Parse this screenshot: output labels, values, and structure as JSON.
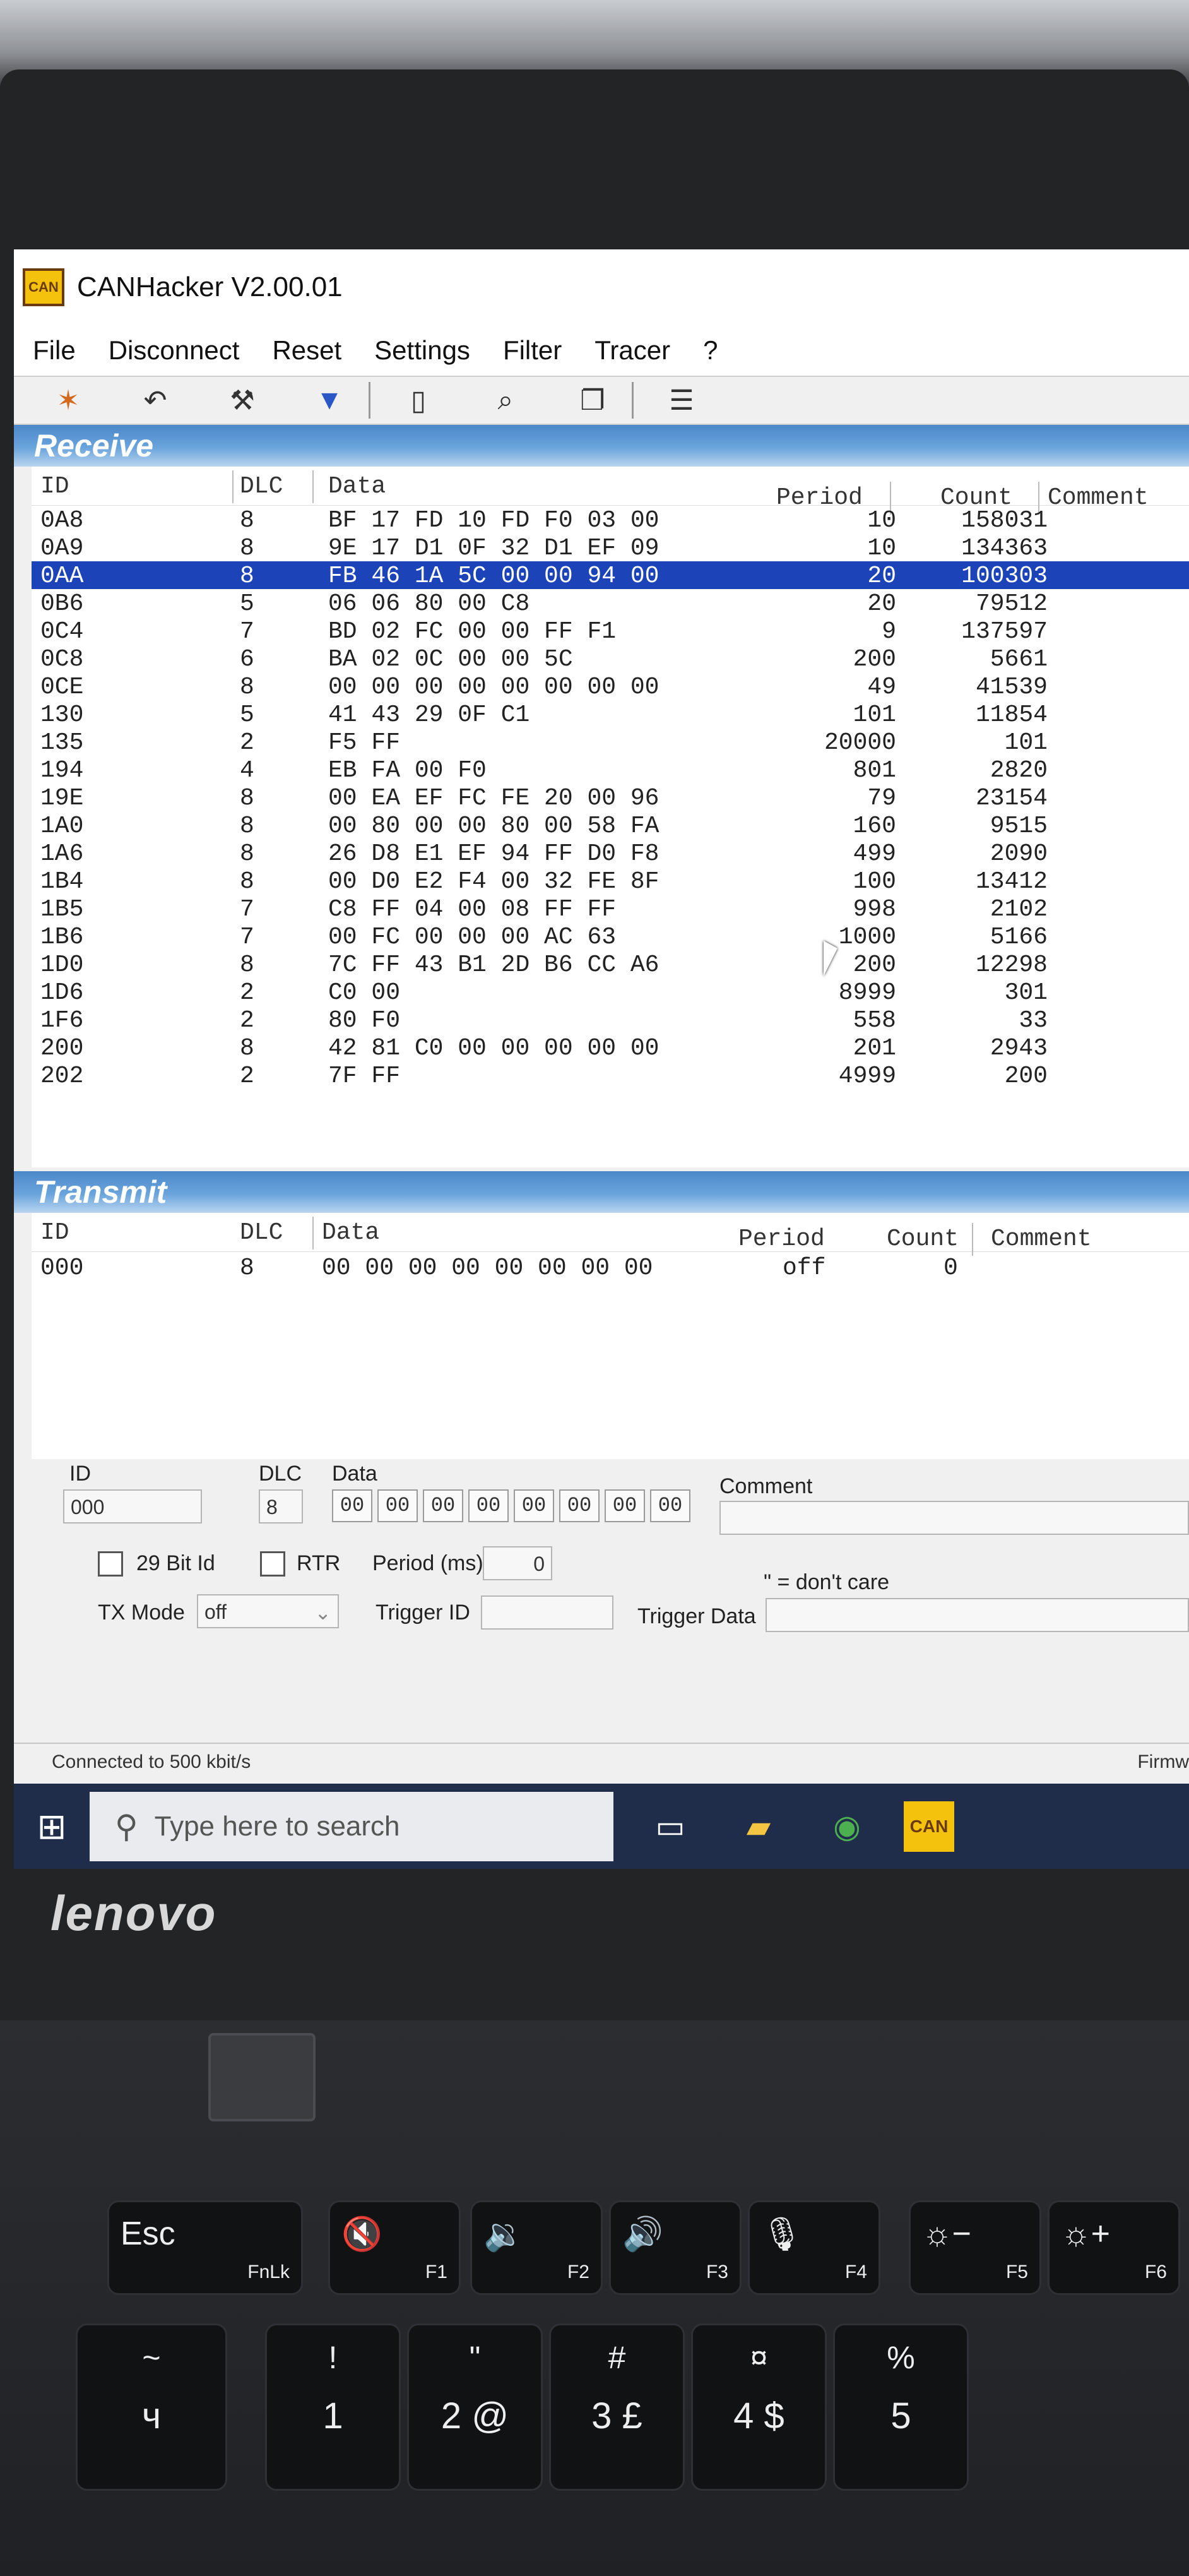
{
  "window": {
    "title": "CANHacker V2.00.01",
    "icon_text": "CAN"
  },
  "menu": [
    "File",
    "Disconnect",
    "Reset",
    "Settings",
    "Filter",
    "Tracer",
    "?"
  ],
  "toolbar_icons": [
    "connect-icon",
    "undo-icon",
    "tools-icon",
    "filter-icon",
    "new-file-icon",
    "preview-icon",
    "copy-icon",
    "log-icon"
  ],
  "receive": {
    "header": "Receive",
    "columns": {
      "id": "ID",
      "dlc": "DLC",
      "data": "Data",
      "period": "Period",
      "count": "Count",
      "comment": "Comment"
    },
    "rows": [
      {
        "id": "0A8",
        "dlc": "8",
        "data": "BF 17 FD 10 FD F0 03 00",
        "period": "10",
        "count": "158031"
      },
      {
        "id": "0A9",
        "dlc": "8",
        "data": "9E 17 D1 0F 32 D1 EF 09",
        "period": "10",
        "count": "134363"
      },
      {
        "id": "0AA",
        "dlc": "8",
        "data": "FB 46 1A 5C 00 00 94 00",
        "period": "20",
        "count": "100303"
      },
      {
        "id": "0B6",
        "dlc": "5",
        "data": "06 06 80 00 C8",
        "period": "20",
        "count": "79512"
      },
      {
        "id": "0C4",
        "dlc": "7",
        "data": "BD 02 FC 00 00 FF F1",
        "period": "9",
        "count": "137597"
      },
      {
        "id": "0C8",
        "dlc": "6",
        "data": "BA 02 0C 00 00 5C",
        "period": "200",
        "count": "5661"
      },
      {
        "id": "0CE",
        "dlc": "8",
        "data": "00 00 00 00 00 00 00 00",
        "period": "49",
        "count": "41539"
      },
      {
        "id": "130",
        "dlc": "5",
        "data": "41 43 29 0F C1",
        "period": "101",
        "count": "11854"
      },
      {
        "id": "135",
        "dlc": "2",
        "data": "F5 FF",
        "period": "20000",
        "count": "101"
      },
      {
        "id": "194",
        "dlc": "4",
        "data": "EB FA 00 F0",
        "period": "801",
        "count": "2820"
      },
      {
        "id": "19E",
        "dlc": "8",
        "data": "00 EA EF FC FE 20 00 96",
        "period": "79",
        "count": "23154"
      },
      {
        "id": "1A0",
        "dlc": "8",
        "data": "00 80 00 00 80 00 58 FA",
        "period": "160",
        "count": "9515"
      },
      {
        "id": "1A6",
        "dlc": "8",
        "data": "26 D8 E1 EF 94 FF D0 F8",
        "period": "499",
        "count": "2090"
      },
      {
        "id": "1B4",
        "dlc": "8",
        "data": "00 D0 E2 F4 00 32 FE 8F",
        "period": "100",
        "count": "13412"
      },
      {
        "id": "1B5",
        "dlc": "7",
        "data": "C8 FF 04 00 08 FF FF",
        "period": "998",
        "count": "2102"
      },
      {
        "id": "1B6",
        "dlc": "7",
        "data": "00 FC 00 00 00 AC 63",
        "period": "1000",
        "count": "5166"
      },
      {
        "id": "1D0",
        "dlc": "8",
        "data": "7C FF 43 B1 2D B6 CC A6",
        "period": "200",
        "count": "12298"
      },
      {
        "id": "1D6",
        "dlc": "2",
        "data": "C0 00",
        "period": "8999",
        "count": "301"
      },
      {
        "id": "1F6",
        "dlc": "2",
        "data": "80 F0",
        "period": "558",
        "count": "33"
      },
      {
        "id": "200",
        "dlc": "8",
        "data": "42 81 C0 00 00 00 00 00",
        "period": "201",
        "count": "2943"
      },
      {
        "id": "202",
        "dlc": "2",
        "data": "7F FF",
        "period": "4999",
        "count": "200"
      }
    ],
    "selected_index": 2
  },
  "transmit": {
    "header": "Transmit",
    "columns": {
      "id": "ID",
      "dlc": "DLC",
      "data": "Data",
      "period": "Period",
      "count": "Count",
      "comment": "Comment"
    },
    "row": {
      "id": "000",
      "dlc": "8",
      "data": "00 00 00 00 00 00 00 00",
      "period": "off",
      "count": "0"
    }
  },
  "edit": {
    "id_label": "ID",
    "id_value": "000",
    "dlc_label": "DLC",
    "dlc_value": "8",
    "data_label": "Data",
    "bytes": [
      "00",
      "00",
      "00",
      "00",
      "00",
      "00",
      "00",
      "00"
    ],
    "comment_label": "Comment",
    "bit29_label": "29 Bit Id",
    "rtr_label": "RTR",
    "period_label": "Period (ms)",
    "period_value": "0",
    "dont_care": "\" = don't care",
    "txmode_label": "TX Mode",
    "txmode_value": "off",
    "trigger_id_label": "Trigger ID",
    "trigger_data_label": "Trigger Data"
  },
  "status": {
    "text": "Connected to 500 kbit/s",
    "right_text": "Firmw"
  },
  "taskbar": {
    "search_placeholder": "Type here to search",
    "apps": [
      "task-view-icon",
      "file-explorer-icon",
      "chrome-icon",
      "canhacker-icon"
    ]
  },
  "laptop": {
    "brand": "lenovo"
  },
  "keyboard": {
    "fn_row": [
      {
        "main": "Esc",
        "sub": "FnLk"
      },
      {
        "main": "🔇",
        "sub": "F1"
      },
      {
        "main": "🔉",
        "sub": "F2"
      },
      {
        "main": "🔊",
        "sub": "F3"
      },
      {
        "main": "🎙",
        "sub": "F4"
      },
      {
        "main": "☼−",
        "sub": "F5"
      },
      {
        "main": "☼+",
        "sub": "F6"
      }
    ],
    "num_row": [
      {
        "top": "~",
        "bottom": "ч"
      },
      {
        "top": "!",
        "bottom": "1"
      },
      {
        "top": "\"",
        "bottom": "2 @"
      },
      {
        "top": "#",
        "bottom": "3 £"
      },
      {
        "top": "¤",
        "bottom": "4 $"
      },
      {
        "top": "%",
        "bottom": "5"
      }
    ]
  }
}
